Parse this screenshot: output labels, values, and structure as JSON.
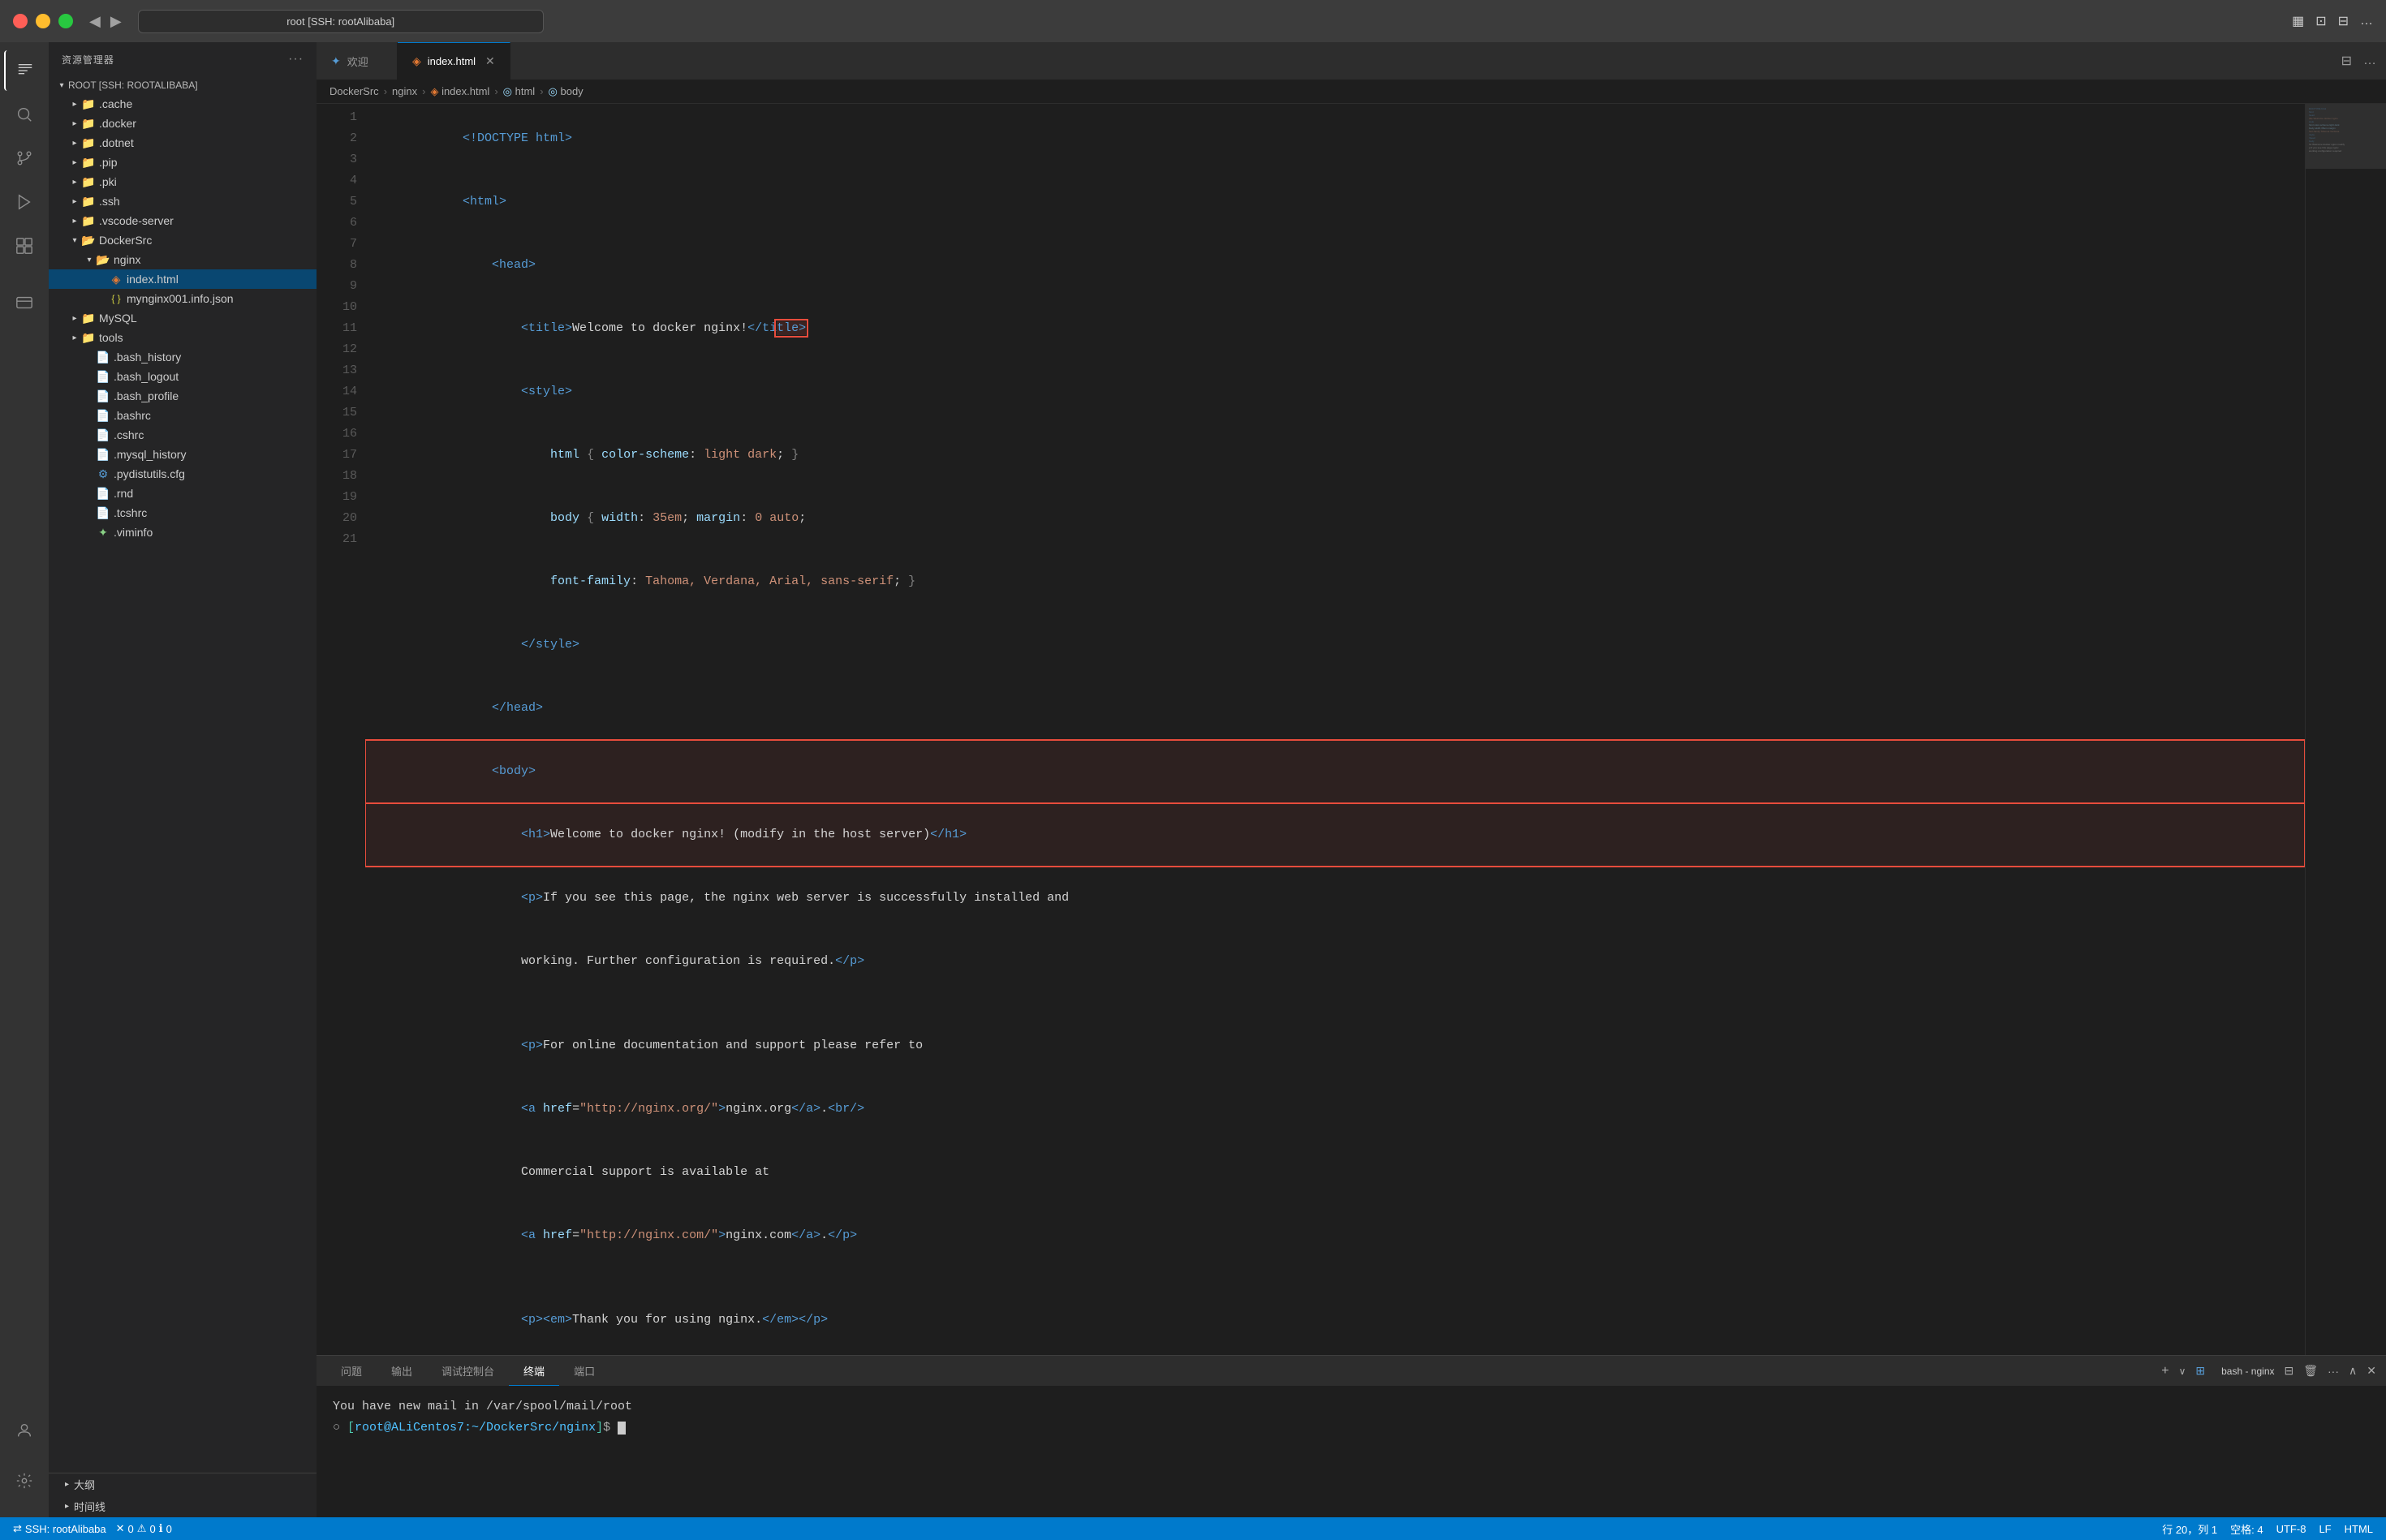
{
  "titlebar": {
    "back_label": "◀",
    "forward_label": "▶",
    "search_text": "root [SSH: rootAlibaba]",
    "layout_icon": "▦",
    "window_icon": "⊡",
    "split_icon": "⊟",
    "more_icon": "…"
  },
  "sidebar": {
    "title": "资源管理器",
    "more_label": "···",
    "root_label": "ROOT [SSH: ROOTALIBABA]",
    "tree": [
      {
        "id": "cache",
        "label": ".cache",
        "type": "folder",
        "indent": 1,
        "expanded": false
      },
      {
        "id": "docker",
        "label": ".docker",
        "type": "folder",
        "indent": 1,
        "expanded": false
      },
      {
        "id": "dotnet",
        "label": ".dotnet",
        "type": "folder",
        "indent": 1,
        "expanded": false
      },
      {
        "id": "pip",
        "label": ".pip",
        "type": "folder",
        "indent": 1,
        "expanded": false
      },
      {
        "id": "pki",
        "label": ".pki",
        "type": "folder",
        "indent": 1,
        "expanded": false
      },
      {
        "id": "ssh",
        "label": ".ssh",
        "type": "folder",
        "indent": 1,
        "expanded": false
      },
      {
        "id": "vscode-server",
        "label": ".vscode-server",
        "type": "folder",
        "indent": 1,
        "expanded": false
      },
      {
        "id": "dockersrc",
        "label": "DockerSrc",
        "type": "folder",
        "indent": 1,
        "expanded": true
      },
      {
        "id": "nginx",
        "label": "nginx",
        "type": "folder",
        "indent": 2,
        "expanded": true
      },
      {
        "id": "index-html",
        "label": "index.html",
        "type": "html",
        "indent": 3,
        "selected": true
      },
      {
        "id": "mynginx-json",
        "label": "mynginx001.info.json",
        "type": "json",
        "indent": 3
      },
      {
        "id": "mysql",
        "label": "MySQL",
        "type": "folder",
        "indent": 1,
        "expanded": false
      },
      {
        "id": "tools",
        "label": "tools",
        "type": "folder",
        "indent": 1,
        "expanded": false
      },
      {
        "id": "bash_history",
        "label": ".bash_history",
        "type": "text",
        "indent": 1
      },
      {
        "id": "bash_logout",
        "label": ".bash_logout",
        "type": "text",
        "indent": 1
      },
      {
        "id": "bash_profile",
        "label": ".bash_profile",
        "type": "text",
        "indent": 1
      },
      {
        "id": "bashrc",
        "label": ".bashrc",
        "type": "text",
        "indent": 1
      },
      {
        "id": "cshrc",
        "label": ".cshrc",
        "type": "text",
        "indent": 1
      },
      {
        "id": "mysql_history",
        "label": ".mysql_history",
        "type": "text",
        "indent": 1
      },
      {
        "id": "pydistutils",
        "label": ".pydistutils.cfg",
        "type": "cfg",
        "indent": 1
      },
      {
        "id": "rnd",
        "label": ".rnd",
        "type": "text",
        "indent": 1
      },
      {
        "id": "tcshrc",
        "label": ".tcshrc",
        "type": "text",
        "indent": 1
      },
      {
        "id": "viminfo",
        "label": ".viminfo",
        "type": "vim",
        "indent": 1
      }
    ],
    "bottom_items": [
      {
        "id": "outline",
        "label": "大纲"
      },
      {
        "id": "timeline",
        "label": "时间线"
      }
    ]
  },
  "tabs": [
    {
      "id": "welcome",
      "label": "欢迎",
      "icon": "✦",
      "active": false
    },
    {
      "id": "index-html",
      "label": "index.html",
      "icon": "◈",
      "active": true,
      "closable": true
    }
  ],
  "breadcrumb": [
    {
      "label": "DockerSrc"
    },
    {
      "label": "nginx"
    },
    {
      "label": "index.html",
      "icon": "◈"
    },
    {
      "label": "html",
      "icon": "◎"
    },
    {
      "label": "body",
      "icon": "◎"
    }
  ],
  "code_lines": [
    {
      "num": 1,
      "content": "<!DOCTYPE html>"
    },
    {
      "num": 2,
      "content": "<html>"
    },
    {
      "num": 3,
      "content": "    <head>"
    },
    {
      "num": 4,
      "content": "        <title>Welcome to docker nginx!</title>",
      "annotated": true
    },
    {
      "num": 5,
      "content": "        <style>"
    },
    {
      "num": 6,
      "content": "            html { color-scheme: light dark; }"
    },
    {
      "num": 7,
      "content": "            body { width: 35em; margin: 0 auto;"
    },
    {
      "num": 8,
      "content": "            font-family: Tahoma, Verdana, Arial, sans-serif; }"
    },
    {
      "num": 9,
      "content": "        </style>"
    },
    {
      "num": 10,
      "content": "    </head>"
    },
    {
      "num": 11,
      "content": "    <body>",
      "annotated": true
    },
    {
      "num": 12,
      "content": "        <h1>Welcome to docker nginx! (modify in the host server)</h1>",
      "annotated": true
    },
    {
      "num": 13,
      "content": "        <p>If you see this page, the nginx web server is successfully installed and"
    },
    {
      "num": 14,
      "content": "        working. Further configuration is required.</p>"
    },
    {
      "num": 15,
      "content": ""
    },
    {
      "num": 16,
      "content": "        <p>For online documentation and support please refer to"
    },
    {
      "num": 17,
      "content": "        <a href=\"http://nginx.org/\">nginx.org</a>.<br/>"
    },
    {
      "num": 18,
      "content": "        Commercial support is available at"
    },
    {
      "num": 19,
      "content": "        <a href=\"http://nginx.com/\">nginx.com</a>.</p>"
    },
    {
      "num": 20,
      "content": ""
    },
    {
      "num": 21,
      "content": "        <p><em>Thank you for using nginx.</em></p>"
    }
  ],
  "terminal": {
    "tabs": [
      {
        "label": "问题"
      },
      {
        "label": "输出"
      },
      {
        "label": "调试控制台"
      },
      {
        "label": "终端",
        "active": true
      },
      {
        "label": "端口"
      }
    ],
    "bash_label": "bash - nginx",
    "add_label": "+",
    "split_label": "⊟",
    "trash_label": "🗑",
    "more_label": "···",
    "up_label": "∧",
    "close_label": "✕",
    "mail_line": "You have new mail in /var/spool/mail/root",
    "prompt_prefix": "○ [",
    "prompt_path": "root@ALiCentos7:~/DockerSrc/nginx",
    "prompt_suffix": "]$ "
  },
  "statusbar": {
    "ssh_label": "SSH: rootAlibaba",
    "errors": "0",
    "warnings": "0",
    "info": "0",
    "line": "行 20，列 1",
    "spaces": "空格: 4",
    "encoding": "UTF-8",
    "line_ending": "LF",
    "lang": "HTML"
  },
  "activity": {
    "items": [
      {
        "id": "files",
        "icon": "⊡",
        "label": "文件资源管理器",
        "active": true
      },
      {
        "id": "search",
        "icon": "⌕",
        "label": "搜索"
      },
      {
        "id": "git",
        "icon": "⎇",
        "label": "源代码管理"
      },
      {
        "id": "debug",
        "icon": "▷",
        "label": "运行和调试"
      },
      {
        "id": "extensions",
        "icon": "⊞",
        "label": "扩展"
      },
      {
        "id": "remote",
        "icon": "⊂⊃",
        "label": "远程资源管理器"
      }
    ],
    "bottom": [
      {
        "id": "account",
        "icon": "◉",
        "label": "帐户"
      },
      {
        "id": "settings",
        "icon": "⚙",
        "label": "管理"
      }
    ]
  }
}
